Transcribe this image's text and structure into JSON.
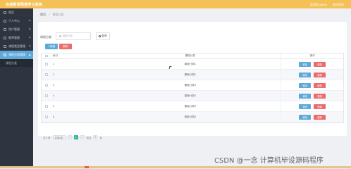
{
  "header": {
    "app_title": "在线教育网课学习系统",
    "welcome_text": "欢迎您 admin",
    "logout_label": "退出登录"
  },
  "sidebar": {
    "items": [
      {
        "label": "首页",
        "icon": "home-icon",
        "has_chevron": false
      },
      {
        "label": "个人中心",
        "icon": "user-icon",
        "has_chevron": true
      },
      {
        "label": "用户管理",
        "icon": "users-icon",
        "has_chevron": true
      },
      {
        "label": "教师管理",
        "icon": "teacher-icon",
        "has_chevron": true
      },
      {
        "label": "课程类型管理",
        "icon": "list-icon",
        "has_chevron": true
      },
      {
        "label": "课程分类管理",
        "icon": "folder-icon",
        "has_chevron": true,
        "active": true
      },
      {
        "label": "课程分类",
        "icon": "",
        "has_chevron": false,
        "sub": true
      }
    ]
  },
  "breadcrumb": {
    "home": "首页",
    "separator": "/",
    "current": "课程分类"
  },
  "search": {
    "label": "课程分类",
    "placeholder": "课程分类",
    "button_label": "查询"
  },
  "actions": {
    "add_label": "+ 新增",
    "delete_label": "删除"
  },
  "table": {
    "headers": {
      "index": "索引",
      "name": "课程分类",
      "ops": "操作"
    },
    "edit_label": "修改",
    "delete_label": "删除",
    "rows": [
      {
        "index": "1",
        "name": "课程分类1"
      },
      {
        "index": "2",
        "name": "课程分类2"
      },
      {
        "index": "3",
        "name": "课程分类3"
      },
      {
        "index": "4",
        "name": "课程分类4"
      },
      {
        "index": "5",
        "name": "课程分类5"
      },
      {
        "index": "6",
        "name": "课程分类6"
      }
    ]
  },
  "pagination": {
    "total_text": "共 6 条",
    "page_size": "10条/页",
    "prev": "<",
    "current_page": "1",
    "next": ">",
    "goto_label": "前往",
    "goto_value": "1",
    "page_suffix": "页"
  },
  "watermark": "CSDN @一念 计算机毕设源码程序",
  "colors": {
    "topbar": "#f5c156",
    "sidebar": "#2f3540",
    "active": "#5fa9d8",
    "danger": "#ec6b6b",
    "page_active": "#3bb49c"
  }
}
